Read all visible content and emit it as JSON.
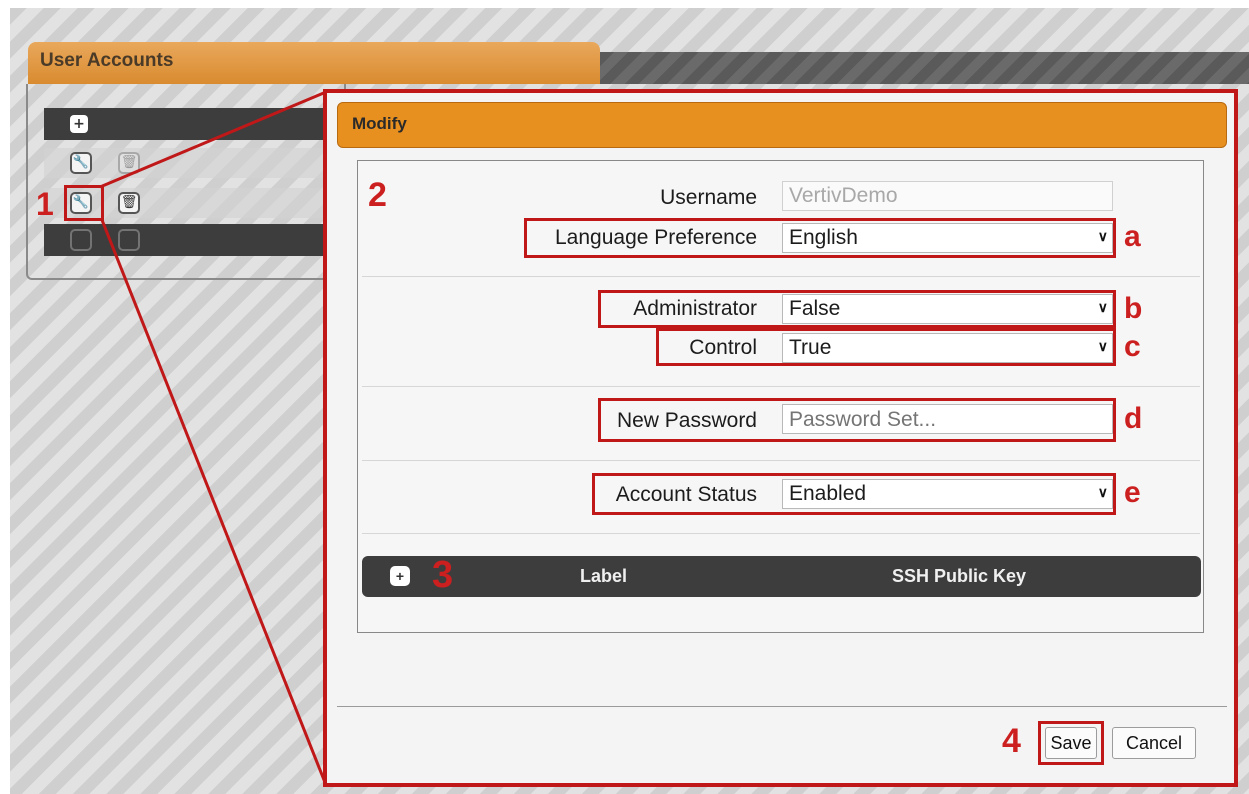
{
  "panel": {
    "title": "User Accounts"
  },
  "icons": {
    "add": "plus-icon",
    "edit": "wrench-icon",
    "delete": "trash-icon"
  },
  "dialog": {
    "title": "Modify",
    "fields": {
      "username": {
        "label": "Username",
        "value": "VertivDemo"
      },
      "language": {
        "label": "Language Preference",
        "value": "English"
      },
      "administrator": {
        "label": "Administrator",
        "value": "False"
      },
      "control": {
        "label": "Control",
        "value": "True"
      },
      "password": {
        "label": "New Password",
        "placeholder": "Password Set..."
      },
      "account_status": {
        "label": "Account Status",
        "value": "Enabled"
      }
    },
    "ssh_table": {
      "columns": [
        "Label",
        "SSH Public Key"
      ]
    },
    "buttons": {
      "save": "Save",
      "cancel": "Cancel"
    }
  },
  "callouts": {
    "n1": "1",
    "n2": "2",
    "n3": "3",
    "n4": "4",
    "a": "a",
    "b": "b",
    "c": "c",
    "d": "d",
    "e": "e"
  },
  "colors": {
    "accent_orange": "#e8901f",
    "callout_red": "#c01818",
    "row_dark": "#3d3d3d"
  }
}
